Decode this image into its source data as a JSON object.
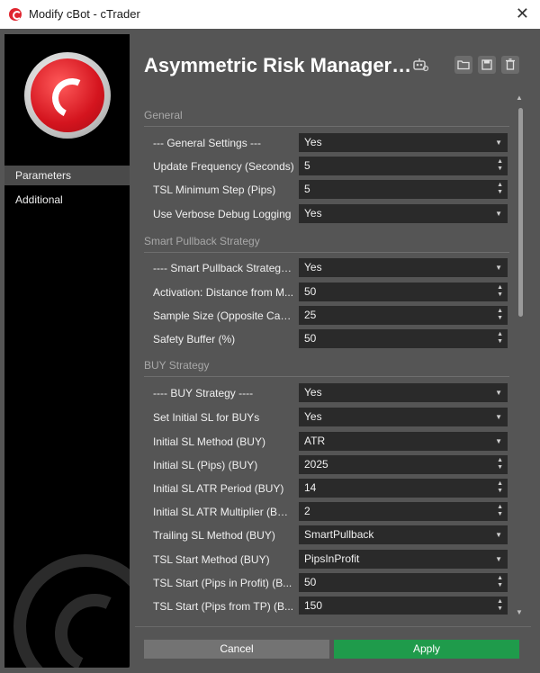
{
  "window": {
    "title": "Modify cBot - cTrader",
    "close_glyph": "✕"
  },
  "sidebar": {
    "items": [
      {
        "label": "Parameters",
        "active": true
      },
      {
        "label": "Additional",
        "active": false
      }
    ]
  },
  "header": {
    "title": "Asymmetric Risk Manager…",
    "icons": [
      "robot-icon",
      "folder-open-icon",
      "save-icon",
      "delete-icon"
    ]
  },
  "sections": [
    {
      "title": "General",
      "rows": [
        {
          "label": "--- General Settings ---",
          "value": "Yes",
          "control": "select"
        },
        {
          "label": "Update Frequency (Seconds)",
          "value": "5",
          "control": "number"
        },
        {
          "label": "TSL Minimum Step (Pips)",
          "value": "5",
          "control": "number"
        },
        {
          "label": "Use Verbose Debug Logging",
          "value": "Yes",
          "control": "select"
        }
      ]
    },
    {
      "title": "Smart Pullback Strategy",
      "rows": [
        {
          "label": "---- Smart Pullback Strategy ----",
          "value": "Yes",
          "control": "select"
        },
        {
          "label": "Activation: Distance from M...",
          "value": "50",
          "control": "number"
        },
        {
          "label": "Sample Size (Opposite Can...",
          "value": "25",
          "control": "number"
        },
        {
          "label": "Safety Buffer (%)",
          "value": "50",
          "control": "number"
        }
      ]
    },
    {
      "title": "BUY Strategy",
      "rows": [
        {
          "label": "---- BUY Strategy ----",
          "value": "Yes",
          "control": "select"
        },
        {
          "label": "Set Initial SL for BUYs",
          "value": "Yes",
          "control": "select"
        },
        {
          "label": "Initial SL Method (BUY)",
          "value": "ATR",
          "control": "select"
        },
        {
          "label": "Initial SL (Pips) (BUY)",
          "value": "2025",
          "control": "number"
        },
        {
          "label": "Initial SL ATR Period (BUY)",
          "value": "14",
          "control": "number"
        },
        {
          "label": "Initial SL ATR Multiplier (BUY)",
          "value": "2",
          "control": "number"
        },
        {
          "label": "Trailing SL Method (BUY)",
          "value": "SmartPullback",
          "control": "select"
        },
        {
          "label": "TSL Start Method (BUY)",
          "value": "PipsInProfit",
          "control": "select"
        },
        {
          "label": "TSL Start (Pips in Profit) (B...",
          "value": "50",
          "control": "number"
        },
        {
          "label": "TSL Start (Pips from TP) (B...",
          "value": "150",
          "control": "number"
        }
      ]
    }
  ],
  "buttons": {
    "cancel": "Cancel",
    "apply": "Apply"
  },
  "colors": {
    "apply": "#1f9b4b",
    "cancel": "#737373",
    "field_bg": "#2a2a2a",
    "panel_bg": "#555555"
  }
}
